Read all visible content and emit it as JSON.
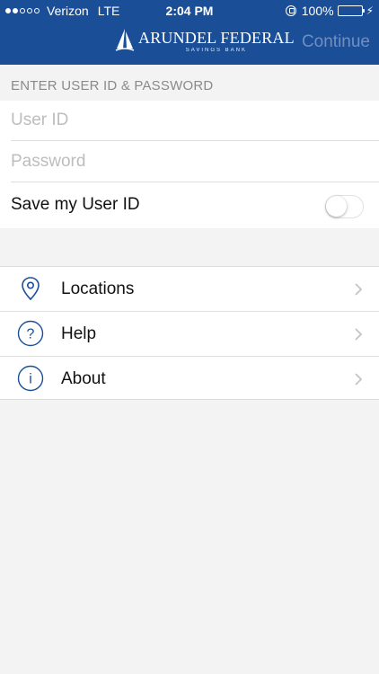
{
  "status_bar": {
    "carrier": "Verizon",
    "network": "LTE",
    "time": "2:04 PM",
    "battery_percent": "100%",
    "signal_bars": 2,
    "signal_total": 5
  },
  "header": {
    "logo_name": "ARUNDEL FEDERAL",
    "logo_sub": "SAVINGS BANK",
    "continue_label": "Continue"
  },
  "login": {
    "section_title": "ENTER USER ID & PASSWORD",
    "user_id_placeholder": "User ID",
    "user_id_value": "",
    "password_placeholder": "Password",
    "password_value": "",
    "save_user_id_label": "Save my User ID",
    "save_user_id_on": false
  },
  "menu": {
    "items": [
      {
        "label": "Locations",
        "icon": "map-pin-icon"
      },
      {
        "label": "Help",
        "icon": "question-circle-icon"
      },
      {
        "label": "About",
        "icon": "info-circle-icon"
      }
    ]
  },
  "colors": {
    "header_bg": "#1a4f98",
    "continue_disabled": "#6f8fc3",
    "icon_blue": "#1a4f98",
    "battery_green": "#5bd55a"
  }
}
